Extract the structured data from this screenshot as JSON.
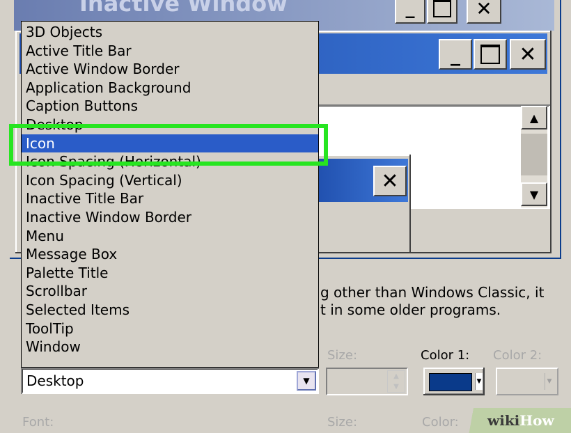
{
  "preview": {
    "inactive_title": "Inactive Window",
    "description_line1": "g other than Windows Classic, it",
    "description_line2": "t in some older programs.",
    "close_glyph": "✕",
    "min_glyph": "_"
  },
  "item_list": [
    "3D Objects",
    "Active Title Bar",
    "Active Window Border",
    "Application Background",
    "Caption Buttons",
    "Desktop",
    "Icon",
    "Icon Spacing (Horizontal)",
    "Icon Spacing (Vertical)",
    "Inactive Title Bar",
    "Inactive Window Border",
    "Menu",
    "Message Box",
    "Palette Title",
    "Scrollbar",
    "Selected Items",
    "ToolTip",
    "Window"
  ],
  "selected_index": 6,
  "item_select": {
    "value": "Desktop"
  },
  "labels": {
    "size": "Size:",
    "color1": "Color 1:",
    "color2": "Color 2:",
    "font": "Font:",
    "size2": "Size:",
    "color": "Color:"
  },
  "colors": {
    "color1_swatch": "#0a3a8a",
    "highlight_outline": "#27e521",
    "selection": "#2a5cc8",
    "desktop": "#0a3c8c"
  },
  "watermark": {
    "wiki": "wiki",
    "how": "How"
  }
}
